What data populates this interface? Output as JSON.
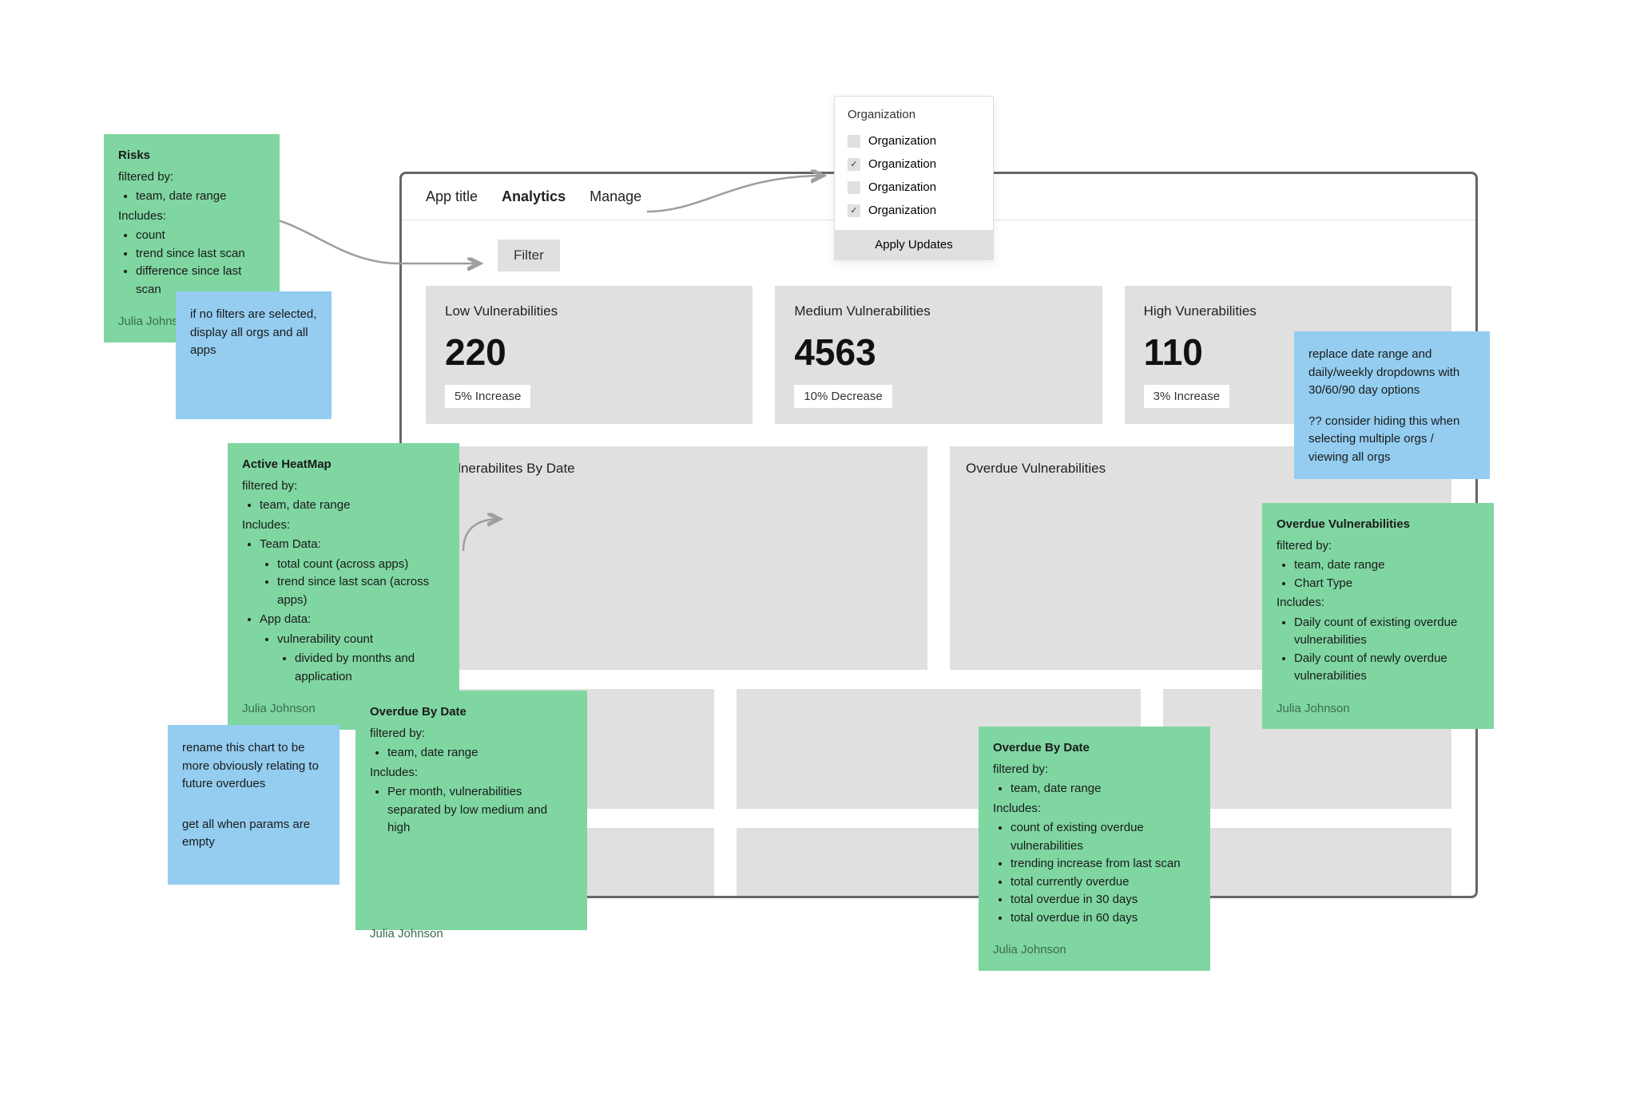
{
  "app": {
    "title": "App title",
    "nav": {
      "analytics": "Analytics",
      "manage": "Manage"
    },
    "filter_label": "Filter"
  },
  "org_popover": {
    "header": "Organization",
    "options": [
      {
        "label": "Organization",
        "checked": false
      },
      {
        "label": "Organization",
        "checked": true
      },
      {
        "label": "Organization",
        "checked": false
      },
      {
        "label": "Organization",
        "checked": true
      }
    ],
    "apply_label": "Apply Updates"
  },
  "stats": [
    {
      "title": "Low Vulnerabilities",
      "value": "220",
      "delta": "5% Increase"
    },
    {
      "title": "Medium Vulnerabilities",
      "value": "4563",
      "delta": "10% Decrease"
    },
    {
      "title": "High Vunerabilities",
      "value": "110",
      "delta": "3% Increase"
    }
  ],
  "charts": {
    "by_date": "Vulnerabilites By Date",
    "overdue": "Overdue Vulnerabilities"
  },
  "notes": {
    "risks": {
      "title": "Risks",
      "filtered_by_label": "filtered by:",
      "filtered_by": [
        "team, date range"
      ],
      "includes_label": "Includes:",
      "includes": [
        "count",
        "trend since last scan",
        "difference since last scan"
      ],
      "author": "Julia Johnson"
    },
    "no_filters": {
      "text": "if no filters are selected, display all orgs and all apps"
    },
    "heatmap": {
      "title": "Active HeatMap",
      "filtered_by_label": "filtered by:",
      "filtered_by": [
        "team, date range"
      ],
      "includes_label": "Includes:",
      "l1a": "Team Data:",
      "l1a_items": [
        "total count (across apps)",
        "trend since last scan (across apps)"
      ],
      "l1b": "App data:",
      "l1b_item": "vulnerability count",
      "l1b_sub": "divided by months and application",
      "author": "Julia Johnson"
    },
    "rename": {
      "line1": "rename this chart to be more obviously relating to future overdues",
      "line2": "get all when params are empty"
    },
    "overdue_left": {
      "title": "Overdue By Date",
      "filtered_by_label": "filtered by:",
      "filtered_by": [
        "team, date range"
      ],
      "includes_label": "Includes:",
      "includes": [
        "Per month, vulnerabilities separated by low medium and high"
      ],
      "author": "Julia Johnson"
    },
    "overdue_right": {
      "title": "Overdue By Date",
      "filtered_by_label": "filtered by:",
      "filtered_by": [
        "team, date range"
      ],
      "includes_label": "Includes:",
      "includes": [
        "count of existing overdue vulnerabilities",
        "trending increase from last scan",
        "total currently overdue",
        "total overdue in 30 days",
        "total overdue in 60 days"
      ],
      "author": "Julia Johnson"
    },
    "date_range": {
      "line1": "replace date range and daily/weekly dropdowns with 30/60/90 day options",
      "line2": "?? consider hiding this when selecting multiple orgs / viewing all orgs"
    },
    "overdue_panel": {
      "title": "Overdue Vulnerabilities",
      "filtered_by_label": "filtered by:",
      "filtered_by": [
        "team, date range",
        "Chart Type"
      ],
      "includes_label": "Includes:",
      "includes": [
        "Daily count of existing overdue vulnerabilities",
        "Daily count of newly overdue vulnerabilities"
      ],
      "author": "Julia Johnson"
    }
  }
}
